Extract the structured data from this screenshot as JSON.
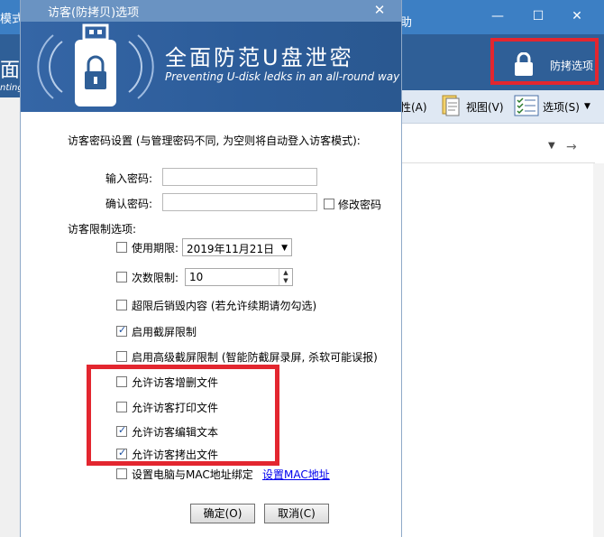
{
  "background": {
    "left_mode_text": "模式",
    "left_big_text": "面",
    "left_small_text": "nting",
    "right_title": "助",
    "window_buttons": [
      "—",
      "☐",
      "✕"
    ],
    "option_label": "防拷选项",
    "toolbar": [
      {
        "label": "性(A)",
        "icon": "properties-icon"
      },
      {
        "label": "视图(V)",
        "icon": "document-icon"
      },
      {
        "label": "选项(S)",
        "icon": "checklist-icon"
      }
    ]
  },
  "dialog": {
    "title": "访客(防拷贝)选项",
    "banner_title": "全面防范U盘泄密",
    "banner_subtitle": "Preventing U-disk ledks in an all-round way",
    "password_section_label": "访客密码设置 (与管理密码不同, 为空则将自动登入访客模式):",
    "input_password_label": "输入密码:",
    "input_password_value": "",
    "confirm_password_label": "确认密码:",
    "confirm_password_value": "",
    "change_password_label": "修改密码",
    "change_password_checked": false,
    "restrictions_label": "访客限制选项:",
    "expiry_label": "使用期限:",
    "expiry_checked": false,
    "expiry_date": "2019年11月21日",
    "count_label": "次数限制:",
    "count_checked": false,
    "count_value": "10",
    "options": [
      {
        "label": "超限后销毁内容 (若允许续期请勿勾选)",
        "checked": false
      },
      {
        "label": "启用截屏限制",
        "checked": true
      },
      {
        "label": "启用高级截屏限制 (智能防截屏录屏, 杀软可能误报)",
        "checked": false
      },
      {
        "label": "允许访客增删文件",
        "checked": false
      },
      {
        "label": "允许访客打印文件",
        "checked": false
      },
      {
        "label": "允许访客编辑文本",
        "checked": true
      },
      {
        "label": "允许访客拷出文件",
        "checked": true
      },
      {
        "label": "设置电脑与MAC地址绑定",
        "checked": false
      }
    ],
    "mac_link": "设置MAC地址",
    "ok_button": "确定(O)",
    "cancel_button": "取消(C)"
  },
  "colors": {
    "highlight_red": "#e3262f",
    "banner_blue": "#2f5f97"
  }
}
